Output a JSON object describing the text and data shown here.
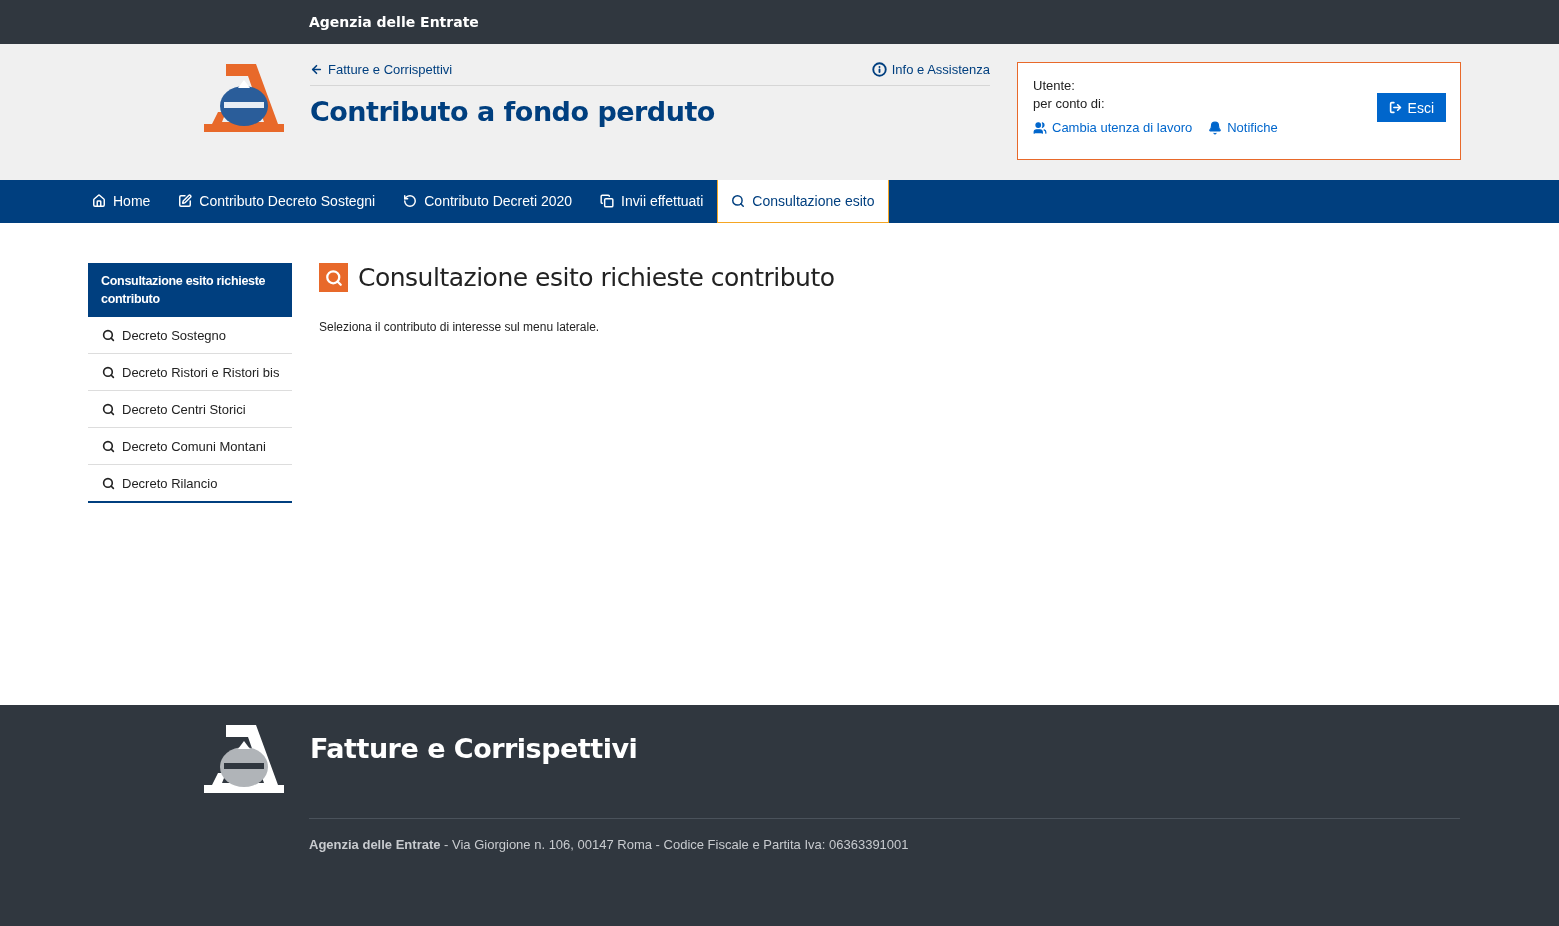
{
  "top_bar": {
    "title": "Agenzia delle Entrate"
  },
  "header": {
    "back_link": "Fatture e Corrispettivi",
    "info_link": "Info e Assistenza",
    "title": "Contributo a fondo perduto"
  },
  "user_box": {
    "user_label": "Utente:",
    "on_behalf_label": "per conto di:",
    "logout_button": "Esci",
    "links": [
      {
        "kind": "users",
        "label": "Cambia utenza di lavoro"
      },
      {
        "kind": "bell",
        "label": "Notifiche"
      }
    ]
  },
  "nav": {
    "tabs": [
      {
        "kind": "home",
        "label": "Home",
        "selected": false
      },
      {
        "kind": "edit",
        "label": "Contributo Decreto Sostegni",
        "selected": false
      },
      {
        "kind": "undo",
        "label": "Contributo Decreti 2020",
        "selected": false
      },
      {
        "kind": "copy",
        "label": "Invii effettuati",
        "selected": false
      },
      {
        "kind": "search",
        "label": "Consultazione esito",
        "selected": true
      }
    ]
  },
  "sidebar": {
    "title": "Consultazione esito richieste contributo",
    "items": [
      {
        "label": "Decreto Sostegno"
      },
      {
        "label": "Decreto Ristori e Ristori bis"
      },
      {
        "label": "Decreto Centri Storici"
      },
      {
        "label": "Decreto Comuni Montani"
      },
      {
        "label": "Decreto Rilancio"
      }
    ]
  },
  "main": {
    "heading": "Consultazione esito richieste contributo",
    "text": "Seleziona il contributo di interesse sul menu laterale."
  },
  "footer": {
    "title": "Fatture e Corrispettivi",
    "address": "**Agenzia delle Entrate** - Via Giorgione n. 106, 00147 Roma - Codice Fiscale e Partita Iva: 06363391001"
  }
}
